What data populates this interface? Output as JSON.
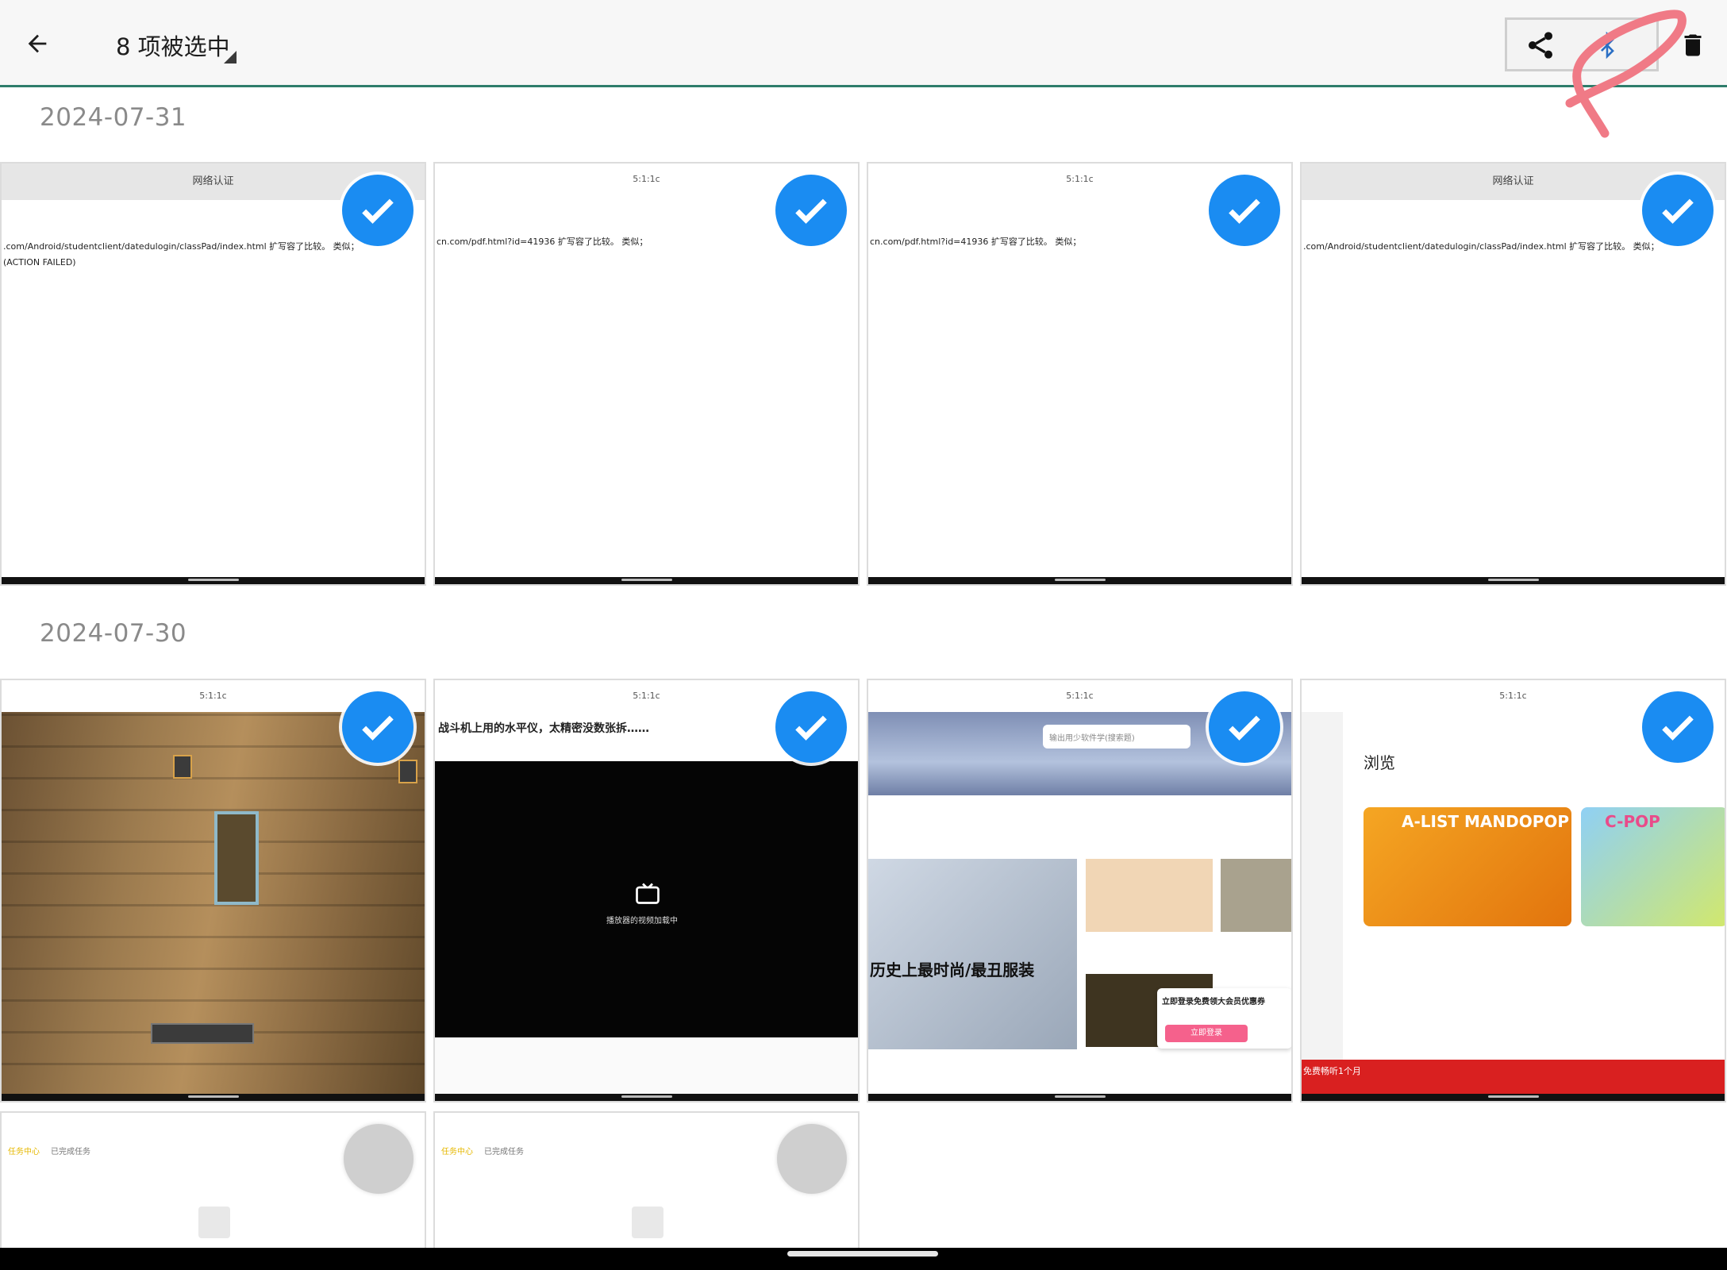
{
  "header": {
    "title": "8 项被选中"
  },
  "groups": [
    {
      "date": "2024-07-31",
      "items": [
        {
          "header_text": "网络认证",
          "line1": ".com/Android/studentclient/datedulogin/classPad/index.html 扩写容了比较。  类似；",
          "line2": "(ACTION FAILED)"
        },
        {
          "header_text": "5:1:1c",
          "line1": "cn.com/pdf.html?id=41936 扩写容了比较。  类似；"
        },
        {
          "header_text": "5:1:1c",
          "line1": "cn.com/pdf.html?id=41936 扩写容了比较。  类似；"
        },
        {
          "header_text": "网络认证",
          "line1": ".com/Android/studentclient/datedulogin/classPad/index.html 扩写容了比较。  类似；"
        }
      ]
    },
    {
      "date": "2024-07-30",
      "items": [
        {
          "header_text": "5:1:1c"
        },
        {
          "header_text": "5:1:1c",
          "video_title": "战斗机上用的水平仪，太精密没数张拆……",
          "player_hint": "播放器的视频加载中"
        },
        {
          "header_text": "5:1:1c",
          "search_placeholder": "输出用少软件学(搜索题)",
          "banner_text": "历史上最时尚/最丑服装",
          "promo_text": "立即登录免费领大会员优惠券",
          "promo_button": "立即登录"
        },
        {
          "header_text": "5:1:1c",
          "browse_title": "浏览",
          "card1_title": "A-LIST MANDOPOP",
          "card2_title": "C-POP",
          "red_banner": "免费畅听1个月"
        }
      ]
    },
    {
      "items": [
        {
          "tab1": "任务中心",
          "tab2": "已完成任务"
        },
        {
          "tab1": "任务中心",
          "tab2": "已完成任务"
        }
      ]
    }
  ],
  "icons": {
    "back": "arrow-left-icon",
    "share": "share-icon",
    "bluetooth": "bluetooth-icon",
    "delete": "trash-icon",
    "check": "check-circle-icon"
  },
  "colors": {
    "accent": "#1a8cf2",
    "appbar_line": "#2e7d6b",
    "scribble": "#f07a86"
  }
}
